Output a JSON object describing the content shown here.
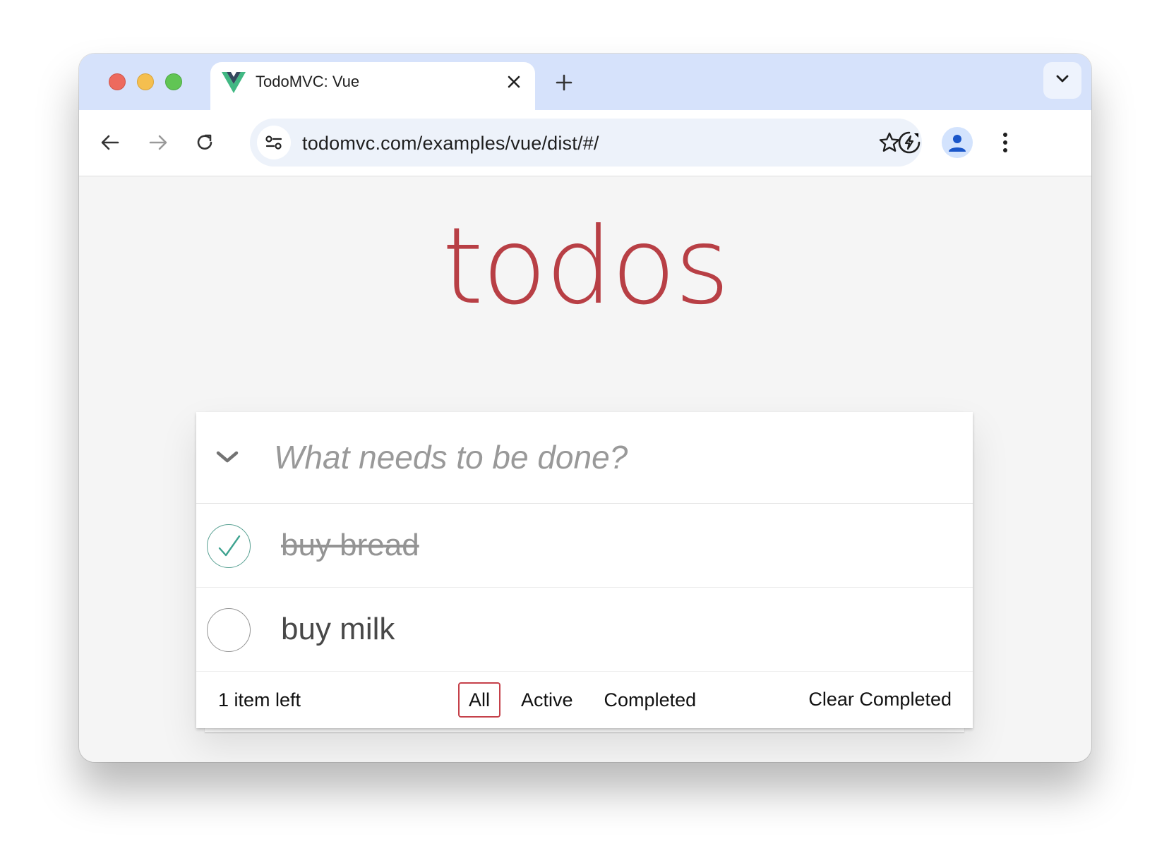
{
  "browser": {
    "tab_title": "TodoMVC: Vue",
    "url": "todomvc.com/examples/vue/dist/#/",
    "icons": [
      "vue-logo-icon",
      "close-icon",
      "plus-icon",
      "chevron-down-icon",
      "back-arrow-icon",
      "forward-arrow-icon",
      "reload-icon",
      "site-settings-icon",
      "star-icon",
      "performance-icon",
      "profile-icon",
      "more-vert-icon"
    ]
  },
  "app": {
    "title": "todos",
    "new_todo_placeholder": "What needs to be done?",
    "accent_color": "#b83f45",
    "todos": [
      {
        "label": "buy bread",
        "completed": true
      },
      {
        "label": "buy milk",
        "completed": false
      }
    ],
    "footer": {
      "count_text": "1 item left",
      "filters": [
        "All",
        "Active",
        "Completed"
      ],
      "selected_filter": "All",
      "clear_label": "Clear Completed"
    }
  }
}
